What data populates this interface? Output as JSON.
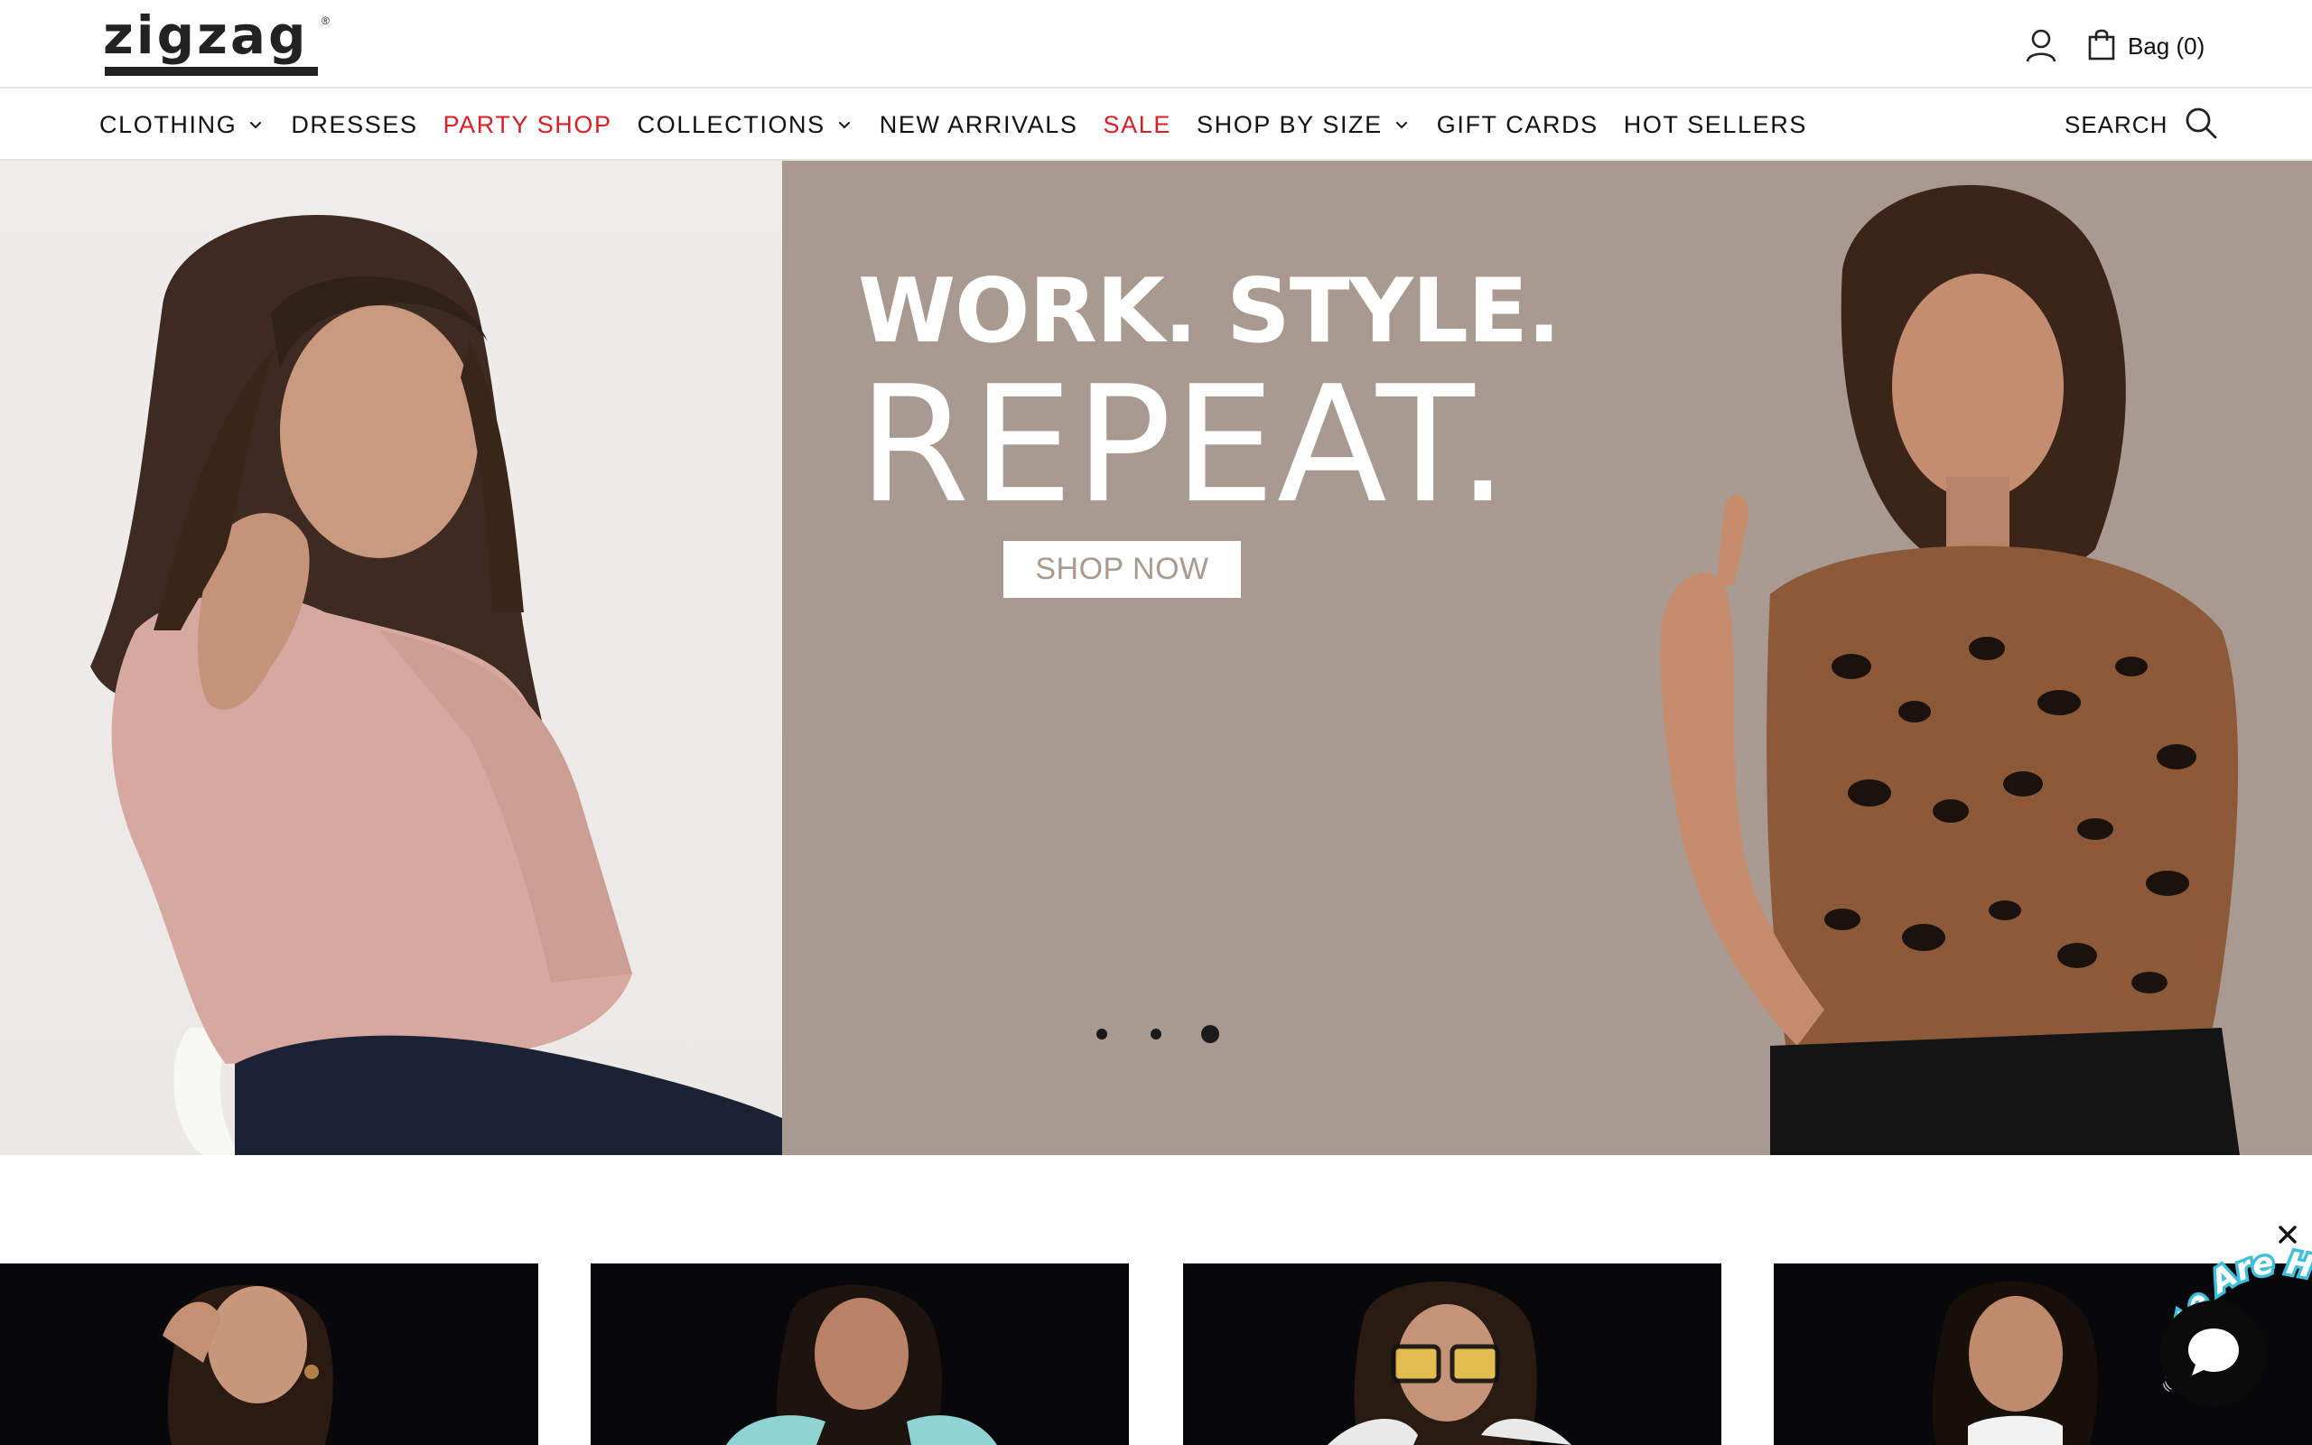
{
  "header": {
    "logo_text": "zigzag",
    "logo_mark": "®",
    "account_icon": "user-icon",
    "bag_icon": "shopping-bag-icon",
    "bag_label": "Bag (0)"
  },
  "nav": {
    "items": [
      {
        "label": "CLOTHING",
        "has_dropdown": true,
        "color": "#111111"
      },
      {
        "label": "DRESSES",
        "has_dropdown": false,
        "color": "#111111"
      },
      {
        "label": "PARTY SHOP",
        "has_dropdown": false,
        "color": "#d81f26"
      },
      {
        "label": "COLLECTIONS",
        "has_dropdown": true,
        "color": "#111111"
      },
      {
        "label": "NEW ARRIVALS",
        "has_dropdown": false,
        "color": "#111111"
      },
      {
        "label": "SALE",
        "has_dropdown": false,
        "color": "#d81f26"
      },
      {
        "label": "SHOP BY SIZE",
        "has_dropdown": true,
        "color": "#111111"
      },
      {
        "label": "GIFT CARDS",
        "has_dropdown": false,
        "color": "#111111"
      },
      {
        "label": "HOT SELLERS",
        "has_dropdown": false,
        "color": "#111111"
      }
    ],
    "search_label": "SEARCH",
    "search_icon": "search-icon"
  },
  "hero": {
    "headline_line1": "WORK. STYLE.",
    "headline_line2": "REPEAT.",
    "cta_label": "SHOP NOW",
    "background_color": "#a89a90",
    "carousel_slides": 3,
    "carousel_active_index": 2
  },
  "tiles": {
    "count": 4,
    "background_color": "#08080a"
  },
  "chat": {
    "badge_text": "We Are Here!",
    "badge_emoji": "👋",
    "close_icon": "close-icon",
    "button_icon": "chat-bubble-icon"
  }
}
